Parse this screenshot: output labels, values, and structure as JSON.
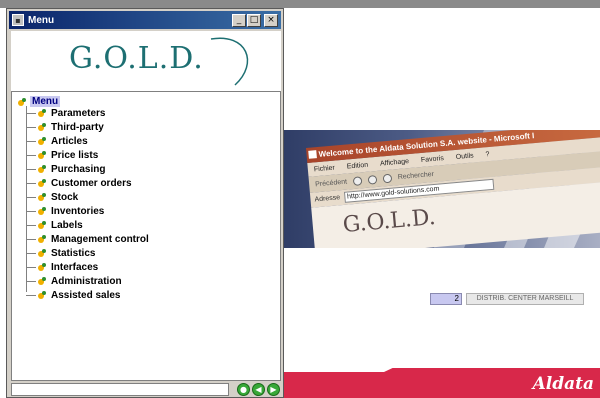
{
  "menu_window": {
    "title": "Menu",
    "buttons": {
      "minimize": "_",
      "maximize": "□",
      "close": "×"
    },
    "logo_text": "G.O.L.D.",
    "tree": {
      "root_label": "Menu",
      "items": [
        {
          "label": "Parameters"
        },
        {
          "label": "Third-party"
        },
        {
          "label": "Articles"
        },
        {
          "label": "Price lists"
        },
        {
          "label": "Purchasing"
        },
        {
          "label": "Customer orders"
        },
        {
          "label": "Stock"
        },
        {
          "label": "Inventories"
        },
        {
          "label": "Labels"
        },
        {
          "label": "Management control"
        },
        {
          "label": "Statistics"
        },
        {
          "label": "Interfaces"
        },
        {
          "label": "Administration"
        },
        {
          "label": "Assisted sales"
        }
      ]
    },
    "nav_buttons": {
      "prev": "◀",
      "next": "▶",
      "go": "●"
    }
  },
  "website": {
    "browser": {
      "title": "Welcome to the Aldata Solution S.A. website - Microsoft I",
      "menu": [
        "Fichier",
        "Edition",
        "Affichage",
        "Favoris",
        "Outils",
        "?"
      ],
      "toolbar": {
        "back": "Précédent",
        "search": "Rechercher"
      },
      "address_label": "Adresse",
      "address_value": "http://www.gold-solutions.com",
      "page_logo": "G.O.L.D."
    },
    "counter_value": "2",
    "center_label": "DISTRIB. CENTER MARSEILL",
    "brand": "Aldata",
    "colors": {
      "brand_red": "#d8284a",
      "logo_teal": "#1d6f72",
      "selection": "#c8c8f0"
    }
  }
}
